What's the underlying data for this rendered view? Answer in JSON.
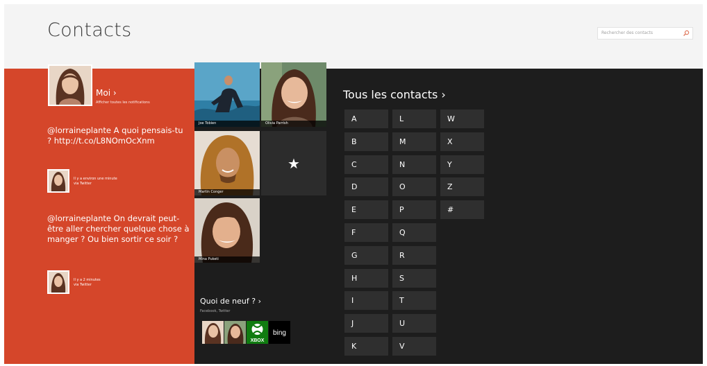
{
  "header": {
    "title": "Contacts",
    "search_placeholder": "Rechercher des contacts"
  },
  "me": {
    "name": "Moi ›",
    "subtitle": "Afficher toutes les notifications"
  },
  "feed": [
    {
      "text": "@lorraineplante A quoi pensais-tu ? http://t.co/L8NOmOcXnm",
      "meta_time": "Il y a environ une minute",
      "meta_via": "via Twitter"
    },
    {
      "text": "@lorraineplante On devrait peut-être aller chercher quelque chose à manger ? Ou bien sortir ce soir ?",
      "meta_time": "Il y a 2 minutes",
      "meta_via": "via Twitter"
    }
  ],
  "favorites": [
    {
      "name": "Joe Tobien",
      "photo": "surfer"
    },
    {
      "name": "Olivia Parrish",
      "photo": "woman-smiling"
    },
    {
      "name": "Martin Conger",
      "photo": "man-long-hair"
    },
    {
      "name": "Mina Puketi",
      "photo": "woman-curly-hair"
    }
  ],
  "add_favorite_icon": "star-icon",
  "news": {
    "title": "Quoi de neuf ? ›",
    "subtitle": "Facebook, Twitter",
    "xbox_label": "XBOX",
    "bing_label": "bing"
  },
  "all_contacts": {
    "title": "Tous les contacts ›",
    "letters": [
      "A",
      "B",
      "C",
      "D",
      "E",
      "F",
      "G",
      "H",
      "I",
      "J",
      "K",
      "L",
      "M",
      "N",
      "O",
      "P",
      "Q",
      "R",
      "S",
      "T",
      "U",
      "V",
      "W",
      "X",
      "Y",
      "Z",
      "#"
    ]
  },
  "colors": {
    "accent": "#d5462a",
    "background": "#1d1d1d",
    "header": "#f4f4f4",
    "tile": "#2f2f2f"
  }
}
